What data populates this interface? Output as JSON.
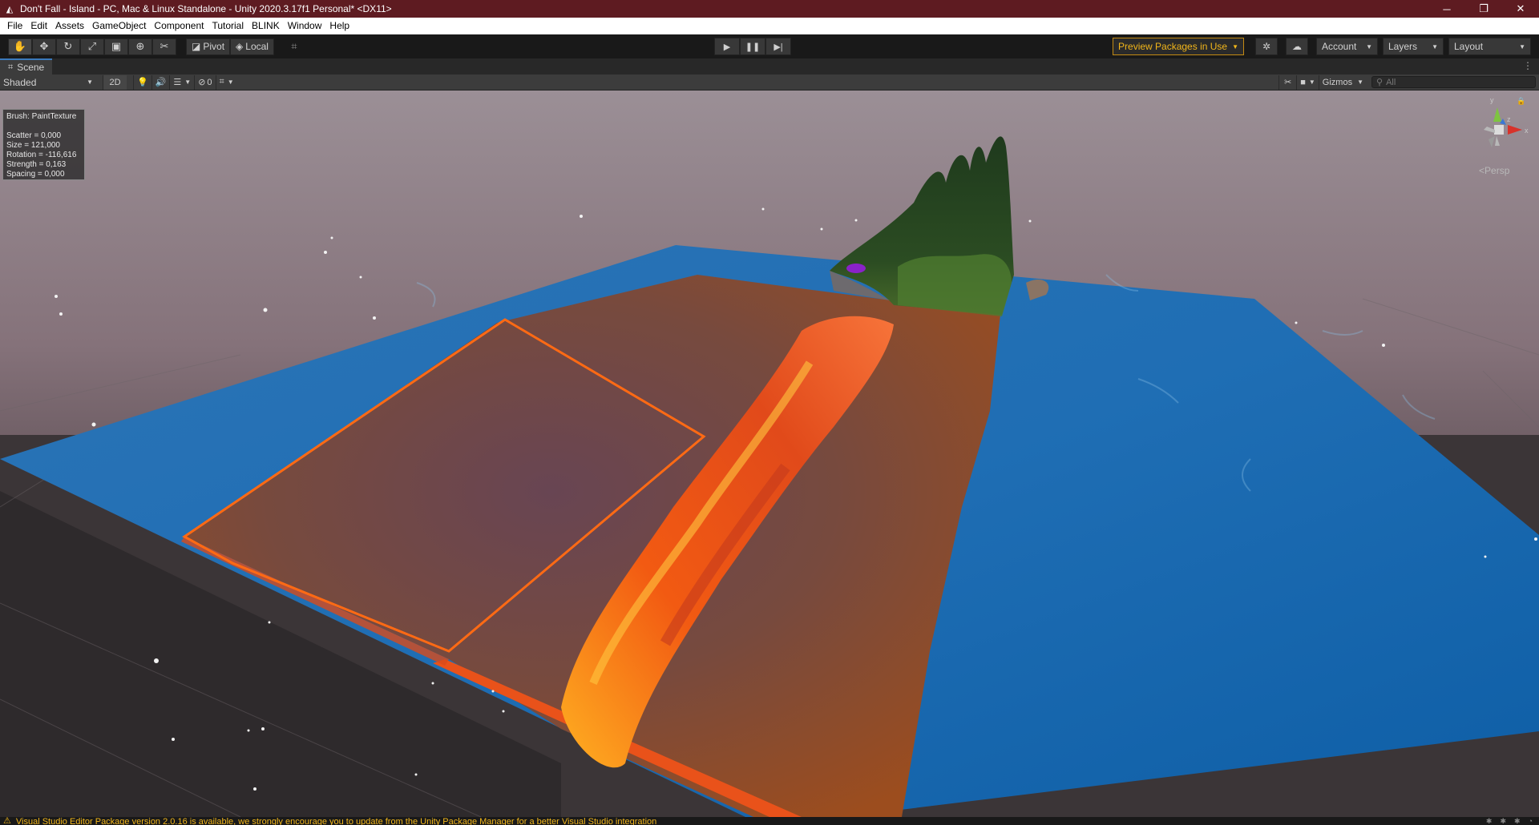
{
  "window": {
    "title": "Don't Fall - Island - PC, Mac & Linux Standalone - Unity 2020.3.17f1 Personal* <DX11>",
    "controls": {
      "minimize": "─",
      "restore": "❐",
      "close": "✕"
    }
  },
  "menu": [
    "File",
    "Edit",
    "Assets",
    "GameObject",
    "Component",
    "Tutorial",
    "BLINK",
    "Window",
    "Help"
  ],
  "toolbar": {
    "tools": [
      "hand-icon",
      "move-icon",
      "rotate-icon",
      "scale-icon",
      "rect-icon",
      "transform-icon",
      "custom-tool-icon"
    ],
    "pivot_label": "Pivot",
    "local_label": "Local",
    "preview_packages": "Preview Packages in Use",
    "account": "Account",
    "layers": "Layers",
    "layout": "Layout"
  },
  "scene_tab": {
    "label": "Scene"
  },
  "scene_toolbar": {
    "shading_mode": "Shaded",
    "mode_2d": "2D",
    "hidden_count": "0",
    "gizmos": "Gizmos",
    "search_placeholder": "All"
  },
  "brush_info": {
    "title": "Brush: PaintTexture",
    "lines": [
      "Scatter = 0,000",
      "Size = 121,000",
      "Rotation = -116,616",
      "Strength = 0,163",
      "Spacing = 0,000"
    ]
  },
  "gizmo": {
    "axis_y": "y",
    "axis_z": "z",
    "axis_x": "x",
    "projection": "Persp"
  },
  "status": {
    "message": "Visual Studio Editor Package version 2.0.16 is available, we strongly encourage you to update from the Unity Package Manager for a better Visual Studio integration"
  }
}
